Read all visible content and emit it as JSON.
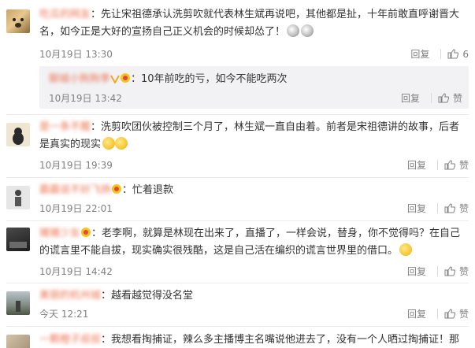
{
  "comments": [
    {
      "user": "吃瓜的网友",
      "text": "：先让宋祖德承认洗剪吹就代表林生斌再说吧，其他都是扯，十年前敢直呼谢晋大名，如今正是大好的宣扬自己正义机会的时候却怂了！",
      "time": "10月19日 13:30",
      "reply_label": "回复",
      "like_count": "6",
      "reply": {
        "user": "聊城小狗狗李",
        "text": "：10年前吃的亏，如今不能吃两次",
        "time": "10月19日 13:42",
        "reply_label": "回复",
        "like_label": "赞"
      }
    },
    {
      "user": "是一条不醒",
      "text": "：洗剪吹团伙被控制三个月了，林生斌一直自由着。前者是宋祖德讲的故事，后者是真实的现实",
      "time": "10月19日 19:39",
      "reply_label": "回复",
      "like_label": "赞"
    },
    {
      "user": "霸霸说不好飞扬",
      "text": "：忙着退款",
      "time": "10月19日 22:01",
      "reply_label": "回复",
      "like_label": "赞"
    },
    {
      "user": "猪猪少女",
      "text": "：老李啊，就算是林现在出来了，直播了，一样会说，替身，你不觉得吗？在自己的谎言里不能自拔，现实确实很残酷，这是自己活在编织的谎言世界里的借口。",
      "time": "10月19日 14:42",
      "reply_label": "回复",
      "like_label": "赞"
    },
    {
      "user": "美丽的杭州城",
      "text": "：越看越觉得没名堂",
      "time": "今天 12:21",
      "reply_label": "回复",
      "like_label": "赞"
    },
    {
      "user": "一颗橙子叔叔",
      "text": "：我想看掏捕证，辣么多主播博主名嘴说他进去了，没有一个人晒过掏捕证！那"
    }
  ],
  "colors": {
    "username": "#eb7350",
    "meta": "#808080",
    "reply_bg": "#f2f2f5"
  },
  "icons": [
    "thumb-up-icon",
    "vip-badge-icon",
    "emoji-icon"
  ]
}
